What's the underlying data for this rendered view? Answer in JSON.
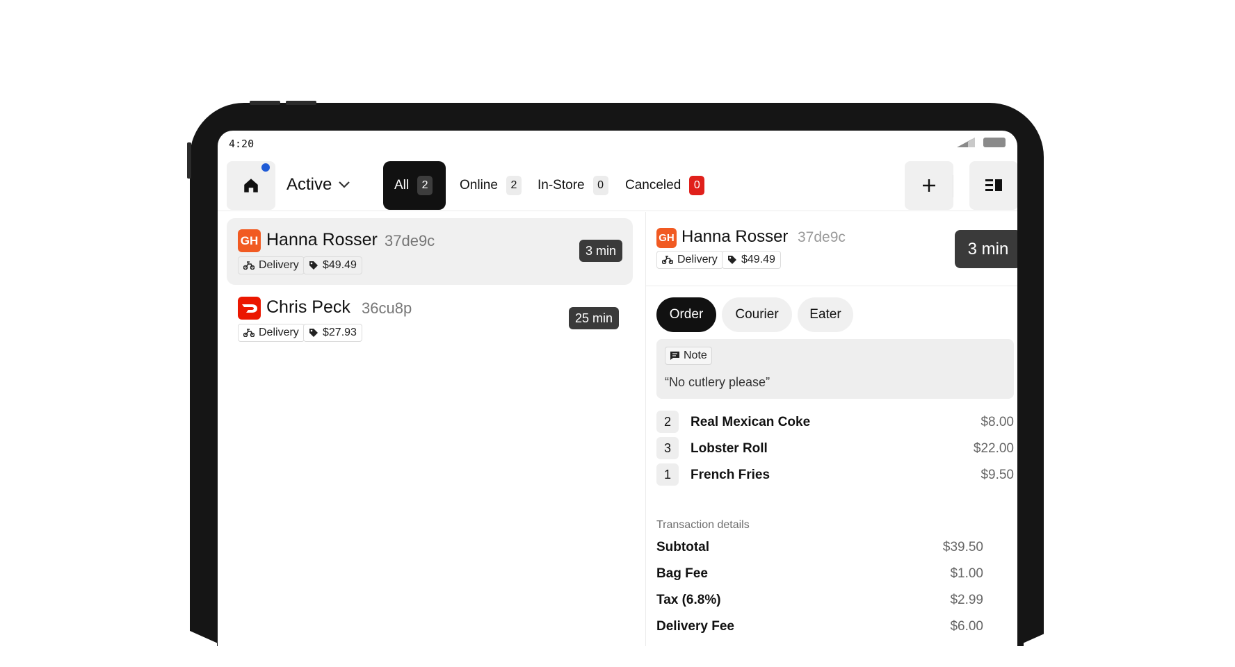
{
  "status_bar": {
    "time": "4:20"
  },
  "header": {
    "view_select": "Active",
    "filters": [
      {
        "label": "All",
        "count": "2",
        "active": true
      },
      {
        "label": "Online",
        "count": "2",
        "active": false
      },
      {
        "label": "In-Store",
        "count": "0",
        "active": false
      },
      {
        "label": "Canceled",
        "count": "0",
        "active": false,
        "alert": true
      }
    ],
    "icons": {
      "home": "home-icon",
      "notification": "notification-dot",
      "dropdown": "chevron-down-icon",
      "add": "plus-icon",
      "panel": "split-view-icon"
    }
  },
  "orders": [
    {
      "brand": "grubhub",
      "brand_color": "#f15a22",
      "brand_logo_text": "GH",
      "customer": "Hanna Rosser",
      "order_id": "37de9c",
      "fulfillment": "Delivery",
      "total": "$49.49",
      "eta": "3 min",
      "selected": true
    },
    {
      "brand": "doordash",
      "brand_color": "#eb1700",
      "customer": "Chris Peck",
      "order_id": "36cu8p",
      "fulfillment": "Delivery",
      "total": "$27.93",
      "eta": "25 min",
      "selected": false
    }
  ],
  "detail": {
    "brand_logo_text": "GH",
    "customer": "Hanna Rosser",
    "order_id": "37de9c",
    "fulfillment": "Delivery",
    "total": "$49.49",
    "eta": "3 min",
    "tabs": [
      "Order",
      "Courier",
      "Eater"
    ],
    "active_tab": "Order",
    "note_label": "Note",
    "note_text": "“No cutlery please”",
    "items": [
      {
        "qty": "2",
        "name": "Real Mexican Coke",
        "price": "$8.00"
      },
      {
        "qty": "3",
        "name": "Lobster Roll",
        "price": "$22.00"
      },
      {
        "qty": "1",
        "name": "French Fries",
        "price": "$9.50"
      }
    ],
    "transaction_label": "Transaction details",
    "transaction": [
      {
        "label": "Subtotal",
        "value": "$39.50"
      },
      {
        "label": "Bag Fee",
        "value": "$1.00"
      },
      {
        "label": "Tax (6.8%)",
        "value": "$2.99"
      },
      {
        "label": "Delivery Fee",
        "value": "$6.00"
      }
    ]
  },
  "colors": {
    "accent_dark": "#111111",
    "notification_blue": "#1f5bd6",
    "alert_red": "#e0201b",
    "grubhub_orange": "#f15a22",
    "doordash_red": "#eb1700"
  }
}
